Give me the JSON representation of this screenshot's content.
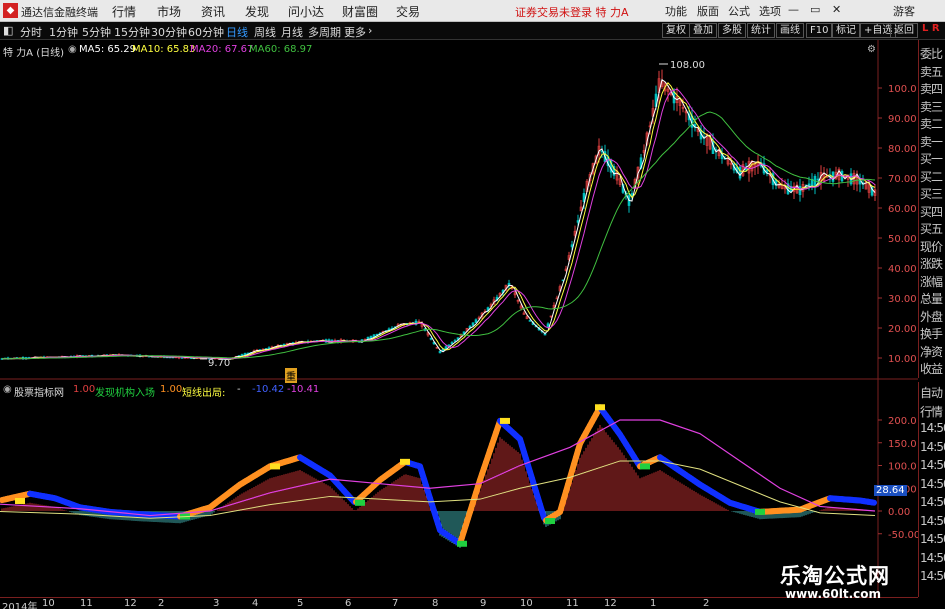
{
  "app": {
    "title": "通达信金融终端",
    "menus": [
      "行情",
      "市场",
      "资讯",
      "发现",
      "问小达",
      "财富圈",
      "交易"
    ],
    "notice": "证券交易未登录 特 力A",
    "right_menus": [
      "功能",
      "版面",
      "公式",
      "选项"
    ],
    "guest": "游客"
  },
  "toolbar": {
    "periods": [
      "分时",
      "1分钟",
      "5分钟",
      "15分钟",
      "30分钟",
      "60分钟",
      "日线",
      "周线",
      "月线",
      "多周期",
      "更多"
    ],
    "active": "日线",
    "right_buttons": [
      "复权",
      "叠加",
      "多股",
      "统计",
      "画线",
      "F10",
      "标记",
      "+自选",
      "返回"
    ]
  },
  "stock": {
    "name_period": "特 力A (日线)",
    "ma5": "MA5: 65.29",
    "ma10": "MA10: 65.83",
    "ma20": "MA20: 67.67",
    "ma60": "MA60: 68.97",
    "high_label": "108.00",
    "low_label": "9.70",
    "event_mark": "重"
  },
  "price_axis": [
    "100.0",
    "90.00",
    "80.00",
    "70.00",
    "60.00",
    "50.00",
    "40.00",
    "30.00",
    "20.00",
    "10.00"
  ],
  "indicator": {
    "name": "股票指标网",
    "v1": "1.00",
    "l1": "发现机构入场",
    "v2": "1.00",
    "l2": "短线出局:",
    "v3": "-",
    "v4": "-10.42",
    "v5": "-10.41",
    "axis": [
      "200.0",
      "150.0",
      "100.0",
      "50.00",
      "0.00",
      "-50.00"
    ],
    "current_value": "28.64"
  },
  "right_strip_top": [
    "委比",
    "卖五",
    "卖四",
    "卖三",
    "卖二",
    "卖一",
    "买一",
    "买二",
    "买三",
    "买四",
    "买五",
    "现价",
    "涨跌",
    "涨幅",
    "总量",
    "外盘",
    "换手",
    "净资",
    "收益"
  ],
  "right_strip_bottom": [
    "自动",
    "行情",
    "14:50",
    "14:50",
    "14:50",
    "14:50",
    "14:50",
    "14:50",
    "14:50",
    "14:50",
    "14:50"
  ],
  "date_axis": [
    "2014年",
    "10",
    "11",
    "12",
    "2",
    "3",
    "4",
    "5",
    "6",
    "7",
    "8",
    "9",
    "10",
    "11",
    "12",
    "1",
    "2"
  ],
  "watermark": {
    "title": "乐淘公式网",
    "url": "www.60lt.com"
  },
  "colors": {
    "up": "#e04040",
    "down": "#00c0c0",
    "ma5": "#ffffff",
    "ma10": "#ffff40",
    "ma20": "#e040e0",
    "ma60": "#40c040",
    "orange": "#ff9020",
    "blue": "#1030ff",
    "green": "#20d040"
  }
}
